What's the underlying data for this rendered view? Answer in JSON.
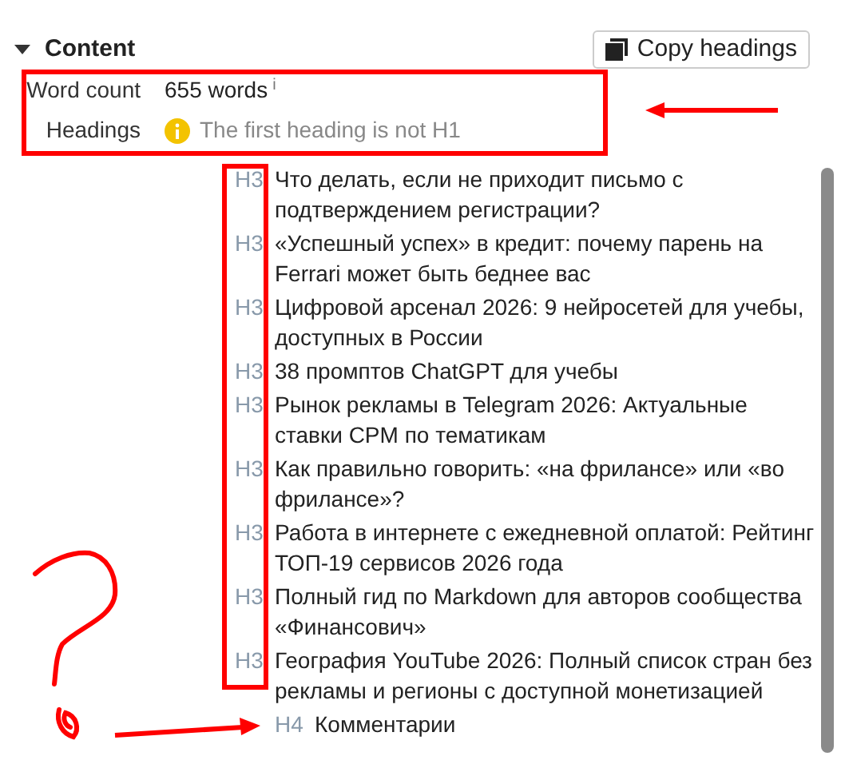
{
  "section": {
    "title": "Content",
    "expanded": true
  },
  "copy_button": {
    "label": "Copy headings"
  },
  "stats": [
    {
      "label": "Word count",
      "value": "655 words",
      "info_mark": "i",
      "kind": "count"
    },
    {
      "label": "Headings",
      "value": "The first heading is not H1",
      "kind": "warning"
    }
  ],
  "headings": [
    {
      "level": "H3",
      "text": "Что делать, если не приходит письмо с подтверждением регистрации?"
    },
    {
      "level": "H3",
      "text": "«Успешный успех» в кредит: почему парень на Ferrari может быть беднее вас"
    },
    {
      "level": "H3",
      "text": "Цифровой арсенал 2026: 9 нейросетей для учебы, доступных в России"
    },
    {
      "level": "H3",
      "text": "38 промптов ChatGPT для учебы"
    },
    {
      "level": "H3",
      "text": "Рынок рекламы в Telegram 2026: Актуальные ставки CPM по тематикам"
    },
    {
      "level": "H3",
      "text": "Как правильно говорить: «на фрилансе» или «во фрилансе»?"
    },
    {
      "level": "H3",
      "text": "Работа в интернете с ежедневной оплатой: Рейтинг ТОП-19 сервисов 2026 года"
    },
    {
      "level": "H3",
      "text": "Полный гид по Markdown для авторов сообщества «Финансович»"
    },
    {
      "level": "H3",
      "text": "География YouTube 2026: Полный список стран без рекламы и регионы с доступной монетизацией",
      "children": [
        {
          "level": "H4",
          "text": "Комментарии"
        }
      ]
    }
  ]
}
